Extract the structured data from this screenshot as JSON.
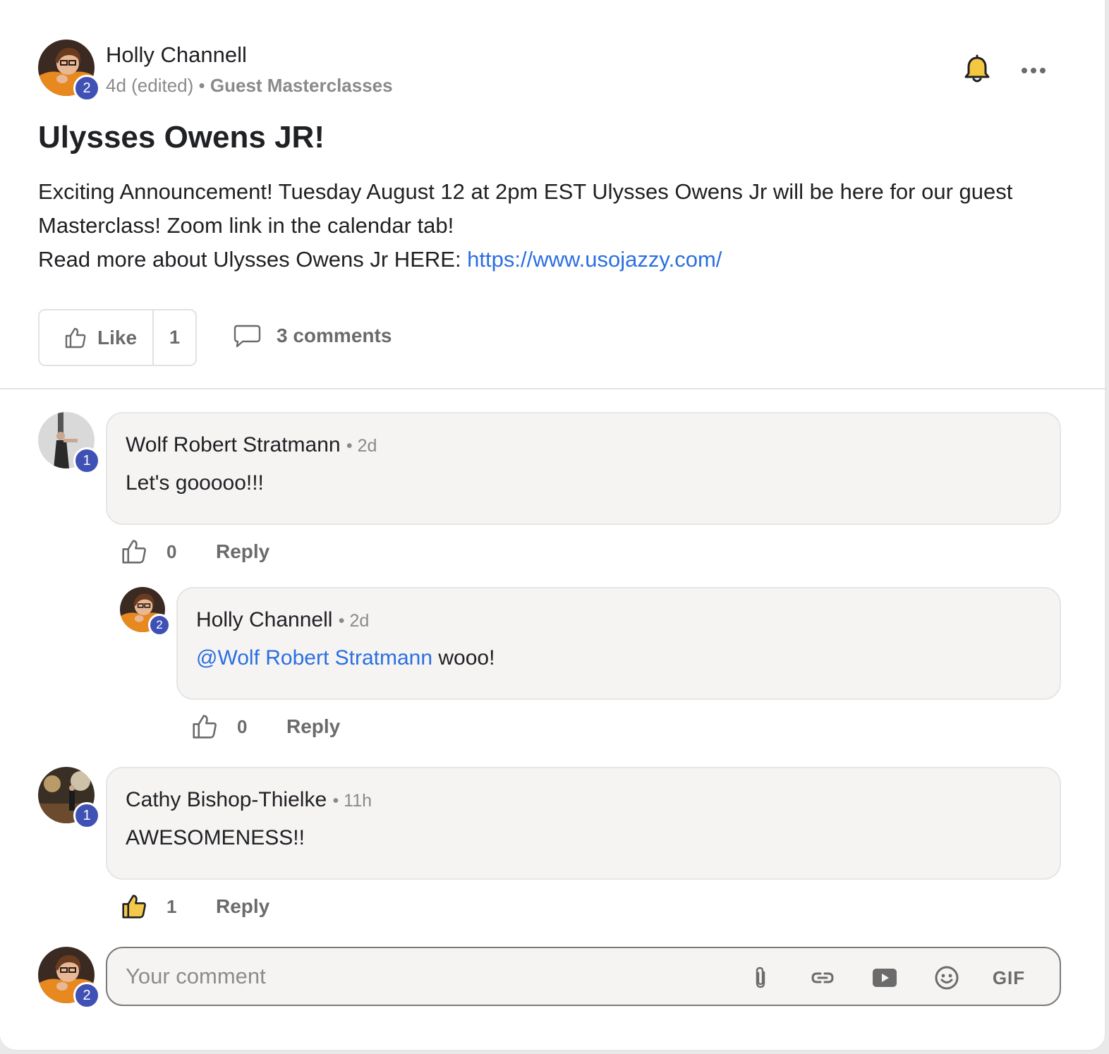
{
  "post": {
    "author": "Holly Channell",
    "author_level": "2",
    "age": "4d (edited)",
    "separator": "•",
    "category": "Guest Masterclasses",
    "title": "Ulysses Owens JR!",
    "body_line1": "Exciting Announcement! Tuesday August 12 at 2pm EST Ulysses Owens Jr will be here for our guest Masterclass! Zoom link in the calendar tab!",
    "body_line2_prefix": "Read more about Ulysses Owens Jr HERE: ",
    "link_text": "https://www.usojazzy.com/",
    "like_label": "Like",
    "like_count": "1",
    "comments_label": "3 comments"
  },
  "comments": [
    {
      "author": "Wolf Robert Stratmann",
      "level": "1",
      "time": "• 2d",
      "text": "Let's gooooo!!!",
      "likes": "0",
      "reply_label": "Reply"
    },
    {
      "author": "Holly Channell",
      "level": "2",
      "time": "• 2d",
      "mention": "@Wolf Robert Stratmann",
      "text": " wooo!",
      "likes": "0",
      "reply_label": "Reply"
    },
    {
      "author": "Cathy Bishop-Thielke",
      "level": "1",
      "time": "• 11h",
      "text": "AWESOMENESS!!",
      "likes": "1",
      "reply_label": "Reply"
    }
  ],
  "composer": {
    "placeholder": "Your comment",
    "level": "2",
    "gif_label": "GIF",
    "icons": [
      "paperclip-icon",
      "link-icon",
      "video-icon",
      "emoji-icon",
      "gif-icon"
    ]
  },
  "colors": {
    "level_badge": "#3f51b5",
    "link": "#2b6fe0",
    "bell": "#f5c842",
    "liked_thumb": "#f2c94c"
  }
}
